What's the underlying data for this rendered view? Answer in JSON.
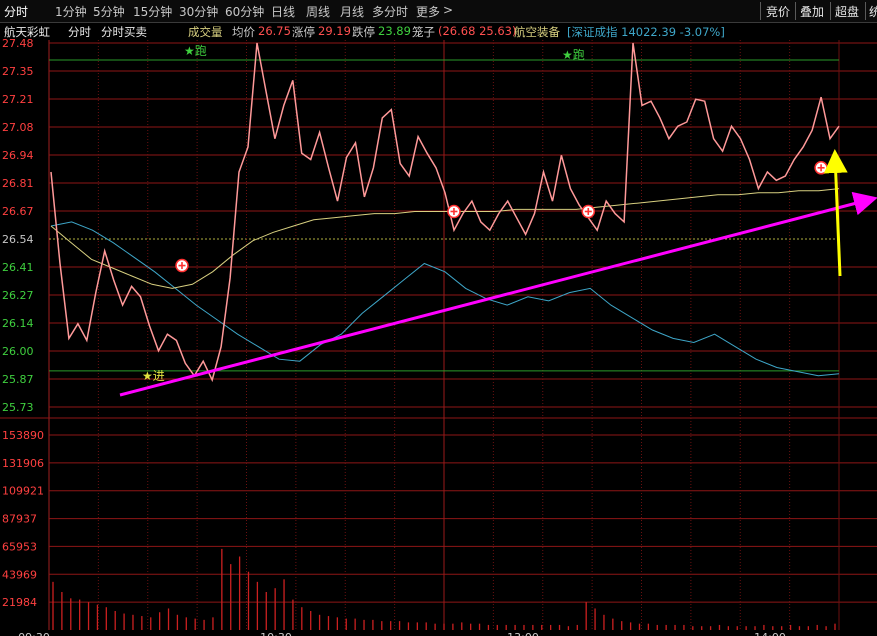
{
  "toolbar": {
    "period_tabs": [
      "分时",
      "1分钟",
      "5分钟",
      "15分钟",
      "30分钟",
      "60分钟",
      "日线",
      "周线",
      "月线",
      "多分时",
      "更多"
    ],
    "more_arrow": ">",
    "right_tabs": [
      "竞价",
      "叠加",
      "超盘",
      "统"
    ]
  },
  "info": {
    "stock_name": "航天彩虹",
    "mode1": "分时",
    "mode2": "分时买卖",
    "volume_label": "成交量",
    "avg_label": "均价",
    "avg_value": "26.75",
    "limit_up_label": "涨停",
    "limit_up_value": "29.19",
    "limit_down_label": "跌停",
    "limit_down_value": "23.89",
    "cage_label": "笼子",
    "cage_value": "(26.68 25.63)",
    "sector": "航空装备",
    "index_text": "[深证成指 14022.39 -3.07%]"
  },
  "colors": {
    "price_line": "#ff9999",
    "avg_line": "#d8d080",
    "index_line": "#3ea6c8",
    "volume_bar": "#cc2020",
    "trend_arrow": "#ff00ff",
    "signal_arrow": "#ffff00"
  },
  "chart_data": {
    "type": "line",
    "price_axis": {
      "ticks": [
        "27.48",
        "27.35",
        "27.21",
        "27.08",
        "26.94",
        "26.81",
        "26.67",
        "26.54",
        "26.41",
        "26.27",
        "26.14",
        "26.00",
        "25.87",
        "25.73"
      ],
      "ylim": [
        25.73,
        27.48
      ],
      "prev_close": 26.54
    },
    "volume_axis": {
      "ticks": [
        "153890",
        "131906",
        "109921",
        "87937",
        "65953",
        "43969",
        "21984"
      ],
      "ylim": [
        0,
        153890
      ]
    },
    "x_labels": [
      "09:30",
      "10:30",
      "13:00",
      "14:00"
    ],
    "price": [
      26.86,
      26.42,
      26.06,
      26.13,
      26.05,
      26.28,
      26.48,
      26.34,
      26.22,
      26.31,
      26.26,
      26.12,
      26.0,
      26.08,
      26.05,
      25.94,
      25.88,
      25.95,
      25.86,
      26.02,
      26.35,
      26.86,
      26.98,
      27.48,
      27.25,
      27.02,
      27.18,
      27.3,
      26.95,
      26.92,
      27.05,
      26.88,
      26.72,
      26.93,
      27.0,
      26.74,
      26.88,
      27.12,
      27.16,
      26.9,
      26.84,
      27.03,
      26.95,
      26.88,
      26.76,
      26.58,
      26.66,
      26.72,
      26.62,
      26.58,
      26.66,
      26.72,
      26.64,
      26.56,
      26.66,
      26.86,
      26.72,
      26.94,
      26.78,
      26.7,
      26.64,
      26.58,
      26.72,
      26.66,
      26.62,
      27.48,
      27.18,
      27.2,
      27.12,
      27.02,
      27.08,
      27.1,
      27.21,
      27.2,
      27.02,
      26.96,
      27.08,
      27.02,
      26.92,
      26.78,
      26.86,
      26.82,
      26.84,
      26.92,
      26.98,
      27.06,
      27.22,
      27.02,
      27.08
    ],
    "avg_price": [
      26.6,
      26.52,
      26.44,
      26.4,
      26.36,
      26.32,
      26.3,
      26.32,
      26.38,
      26.46,
      26.53,
      26.57,
      26.6,
      26.63,
      26.64,
      26.65,
      26.66,
      26.66,
      26.67,
      26.67,
      26.67,
      26.67,
      26.67,
      26.68,
      26.68,
      26.68,
      26.68,
      26.69,
      26.7,
      26.71,
      26.72,
      26.73,
      26.74,
      26.75,
      26.75,
      26.76,
      26.76,
      26.77,
      26.77,
      26.78
    ],
    "index": [
      26.6,
      26.62,
      26.58,
      26.52,
      26.45,
      26.38,
      26.3,
      26.22,
      26.15,
      26.08,
      26.02,
      25.96,
      25.95,
      26.03,
      26.08,
      26.18,
      26.26,
      26.34,
      26.42,
      26.38,
      26.3,
      26.25,
      26.22,
      26.26,
      26.24,
      26.28,
      26.3,
      26.22,
      26.16,
      26.1,
      26.06,
      26.04,
      26.08,
      26.02,
      25.96,
      25.92,
      25.9,
      25.88,
      25.89
    ],
    "volume_max_label": "153890",
    "volume": [
      38000,
      30000,
      25000,
      24000,
      22000,
      20000,
      18000,
      15000,
      13000,
      12000,
      11000,
      10000,
      14000,
      17000,
      12000,
      10000,
      9000,
      8000,
      10000,
      64000,
      52000,
      58000,
      46000,
      38000,
      30000,
      33000,
      40000,
      24000,
      18000,
      15000,
      12000,
      11000,
      10000,
      9000,
      9000,
      8000,
      8000,
      7000,
      7000,
      7000,
      6000,
      6000,
      6000,
      5000,
      5000,
      5000,
      6000,
      5000,
      5000,
      4000,
      4000,
      4000,
      4000,
      4000,
      4000,
      4000,
      4000,
      4000,
      3000,
      4000,
      22000,
      17000,
      12000,
      9000,
      7000,
      6000,
      5000,
      5000,
      4000,
      4000,
      4000,
      4000,
      3000,
      3000,
      3000,
      4000,
      3000,
      3000,
      3000,
      3000,
      4000,
      3000,
      3000,
      4000,
      3000,
      3000,
      4000,
      3000,
      5000
    ],
    "markers": {
      "run_label": "跑",
      "enter_label": "进"
    }
  }
}
